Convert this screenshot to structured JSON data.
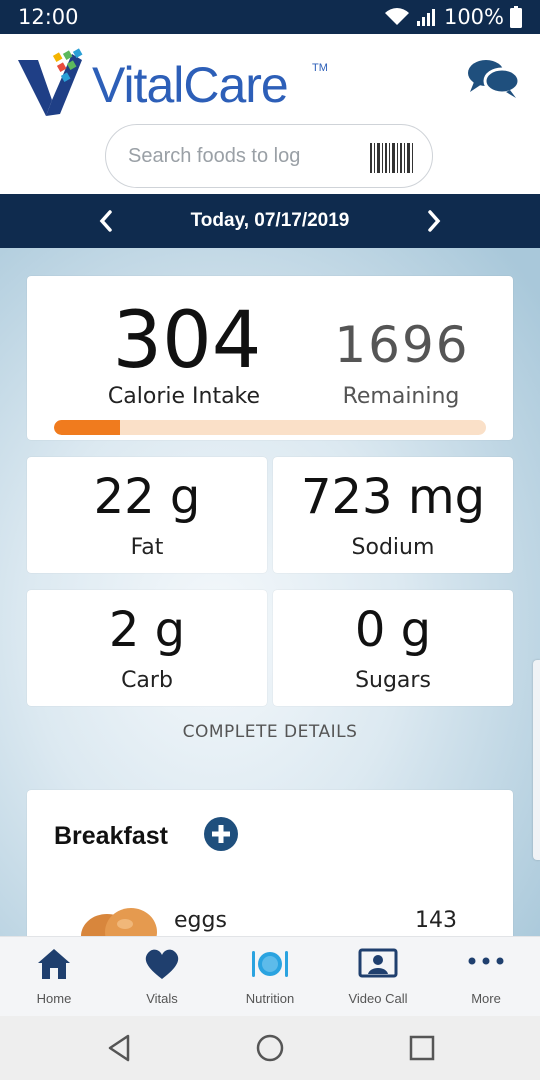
{
  "status_bar": {
    "time": "12:00",
    "battery": "100%"
  },
  "header": {
    "brand": "VitalCare",
    "trademark": "TM",
    "search_placeholder": "Search foods to log"
  },
  "date_nav": {
    "label": "Today, 07/17/2019"
  },
  "summary": {
    "calories_value": "304",
    "calories_label": "Calorie Intake",
    "remaining_value": "1696",
    "remaining_label": "Remaining",
    "progress_fraction": 0.152
  },
  "nutrients": [
    {
      "value": "22 g",
      "label": "Fat"
    },
    {
      "value": "723 mg",
      "label": "Sodium"
    },
    {
      "value": "2 g",
      "label": "Carb"
    },
    {
      "value": "0 g",
      "label": "Sugars"
    }
  ],
  "complete_details_label": "COMPLETE DETAILS",
  "meal": {
    "title": "Breakfast",
    "items": [
      {
        "name": "eggs",
        "calories": "143"
      }
    ]
  },
  "bottom_nav": {
    "items": [
      {
        "label": "Home",
        "icon": "home-icon"
      },
      {
        "label": "Vitals",
        "icon": "heart-icon"
      },
      {
        "label": "Nutrition",
        "icon": "plate-icon"
      },
      {
        "label": "Video Call",
        "icon": "video-call-icon"
      },
      {
        "label": "More",
        "icon": "more-icon"
      }
    ]
  },
  "colors": {
    "navy": "#0f2b4e",
    "brand_blue": "#2d5fb8",
    "accent_orange": "#f07b1e",
    "nutrition_active": "#2aa3e0"
  }
}
